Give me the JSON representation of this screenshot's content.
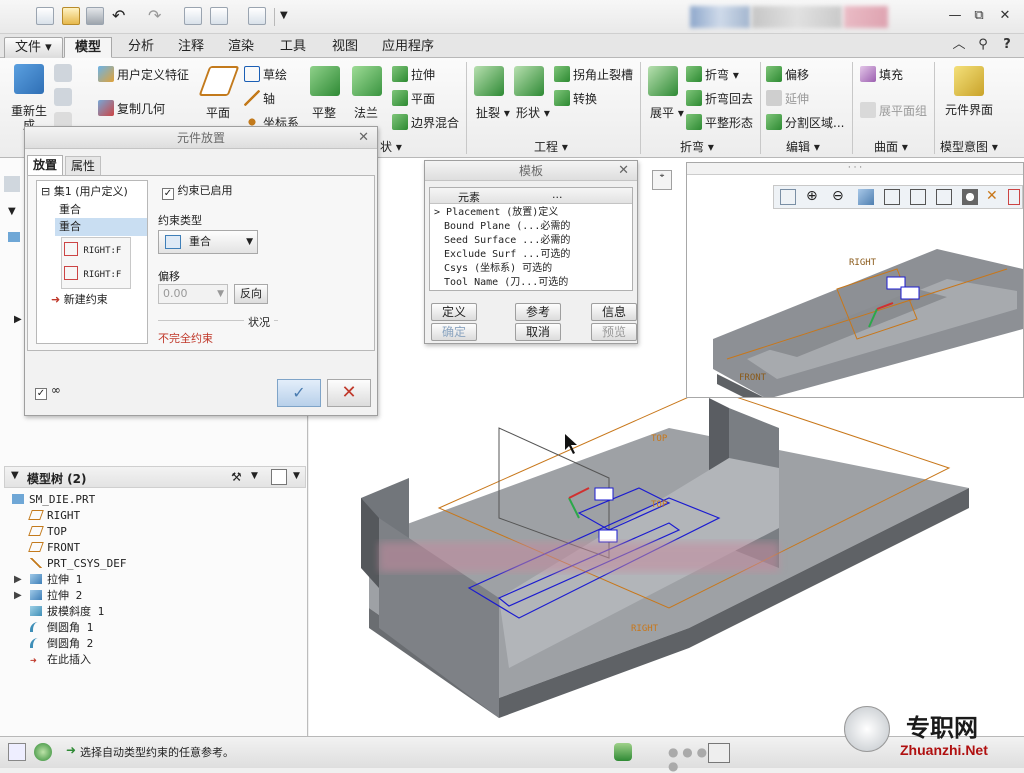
{
  "quick_access": {
    "icons": [
      "new-file-icon",
      "open-folder-icon",
      "save-icon",
      "undo-icon",
      "redo-icon",
      "regenerate-icon",
      "windows-icon",
      "close-window-icon",
      "customize-icon"
    ]
  },
  "window_controls": {
    "minimize": "—",
    "restore": "⧉",
    "close": "✕"
  },
  "tabs": [
    "文件",
    "模型",
    "分析",
    "注释",
    "渲染",
    "工具",
    "视图",
    "应用程序"
  ],
  "ribbon": {
    "regen": "重新生成",
    "user_def_feature": "用户定义特征",
    "copy_geom": "复制几何",
    "plane": "平面",
    "sketch": "草绘",
    "axis": "轴",
    "csys": "坐标系",
    "flat": "平整",
    "flange": "法兰",
    "extrude": "拉伸",
    "plane2": "平面",
    "boundary_blend": "边界混合",
    "tear": "扯裂",
    "form": "形状",
    "corner_relief": "拐角止裂槽",
    "convert": "转换",
    "unbend": "展平",
    "bend": "折弯",
    "bend_back": "折弯回去",
    "flat_form": "平整形态",
    "offset": "偏移",
    "extend": "延伸",
    "split_region": "分割区域...",
    "fill": "填充",
    "flat_group": "展平面组",
    "component_interface": "元件界面",
    "groups": {
      "shape": "状 ▾",
      "engineering": "工程 ▾",
      "bend": "折弯 ▾",
      "edit": "编辑 ▾",
      "surface": "曲面 ▾",
      "model_intent": "模型意图 ▾"
    }
  },
  "place_dialog": {
    "title": "元件放置",
    "tabs": [
      "放置",
      "属性"
    ],
    "set_label": "集1 (用户定义)",
    "constraints": [
      "重合",
      "重合"
    ],
    "refs": [
      "RIGHT:F",
      "RIGHT:F"
    ],
    "new_constraint": "新建约束",
    "enabled_label": "约束已启用",
    "type_label": "约束类型",
    "type_value": "重合",
    "offset_label": "偏移",
    "offset_value": "0.00",
    "flip_label": "反向",
    "status_label": "状况",
    "status_value": "不完全约束"
  },
  "template_dialog": {
    "title": "模板",
    "header": [
      "元素",
      "..."
    ],
    "rows": [
      {
        "name": "Placement",
        "info": "(放置)定义"
      },
      {
        "name": "Bound Plane",
        "info": "(...必需的"
      },
      {
        "name": "Seed Surface",
        "info": "...必需的"
      },
      {
        "name": "Exclude Surf",
        "info": "...可选的"
      },
      {
        "name": "Csys",
        "info": "(坐标系)  可选的"
      },
      {
        "name": "Tool Name",
        "info": "(刀...可选的"
      }
    ],
    "buttons": [
      "定义",
      "参考",
      "信息",
      "确定",
      "取消",
      "预览"
    ]
  },
  "model_tree": {
    "title": "模型树 (2)",
    "items": [
      "SM_DIE.PRT",
      "RIGHT",
      "TOP",
      "FRONT",
      "PRT_CSYS_DEF",
      "拉伸 1",
      "拉伸 2",
      "拔模斜度 1",
      "倒圆角 1",
      "倒圆角 2",
      "在此插入"
    ]
  },
  "viewport_labels": {
    "top": "TOP",
    "right": "RIGHT",
    "top2": "TOP",
    "right_sub": "RIGHT",
    "front_sub": "FRONT"
  },
  "status": {
    "message": "选择自动类型约束的任意参考。"
  },
  "watermark": {
    "cn": "专职网",
    "url": "Zhuanzhi.Net"
  },
  "colors": {
    "model_gray": "#8a8d92",
    "datum_orange": "#c8771a",
    "constraint_blue": "#1b1bd0",
    "error_red": "#c0392b"
  }
}
